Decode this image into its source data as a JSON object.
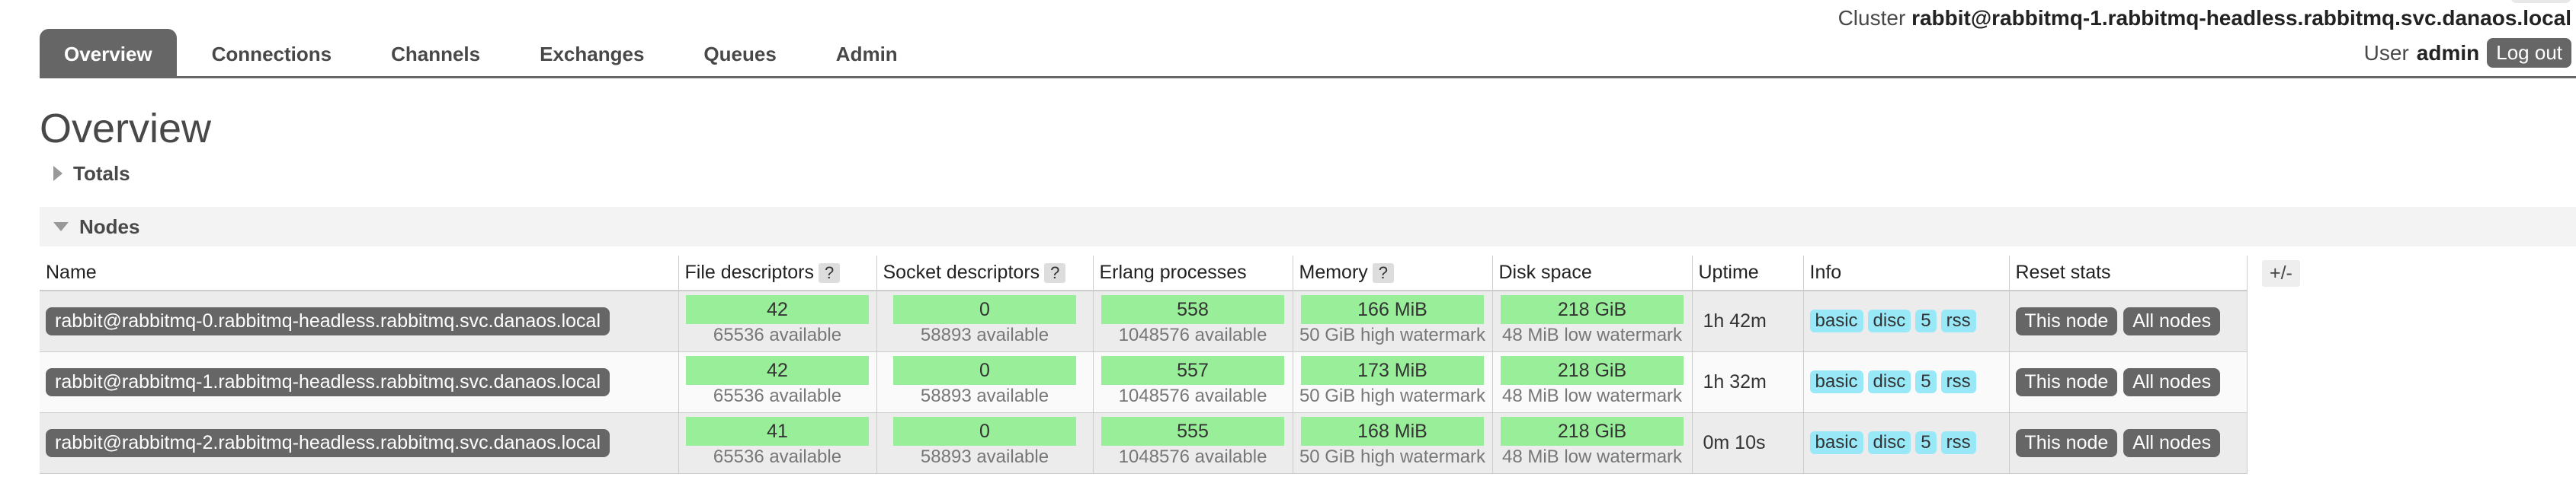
{
  "header": {
    "cluster_label": "Cluster",
    "cluster_name": "rabbit@rabbitmq-1.rabbitmq-headless.rabbitmq.svc.danaos.local",
    "user_label": "User",
    "user_name": "admin",
    "logout_label": "Log out"
  },
  "tabs": [
    {
      "label": "Overview",
      "active": true
    },
    {
      "label": "Connections"
    },
    {
      "label": "Channels"
    },
    {
      "label": "Exchanges"
    },
    {
      "label": "Queues"
    },
    {
      "label": "Admin"
    }
  ],
  "page_title": "Overview",
  "sections": {
    "totals": "Totals",
    "nodes": "Nodes"
  },
  "table": {
    "headers": {
      "name": "Name",
      "file_descriptors": "File descriptors",
      "socket_descriptors": "Socket descriptors",
      "erlang_processes": "Erlang processes",
      "memory": "Memory",
      "disk_space": "Disk space",
      "uptime": "Uptime",
      "info": "Info",
      "reset_stats": "Reset stats"
    },
    "help_glyph": "?",
    "plus_minus": "+/-",
    "rows": [
      {
        "name": "rabbit@rabbitmq-0.rabbitmq-headless.rabbitmq.svc.danaos.local",
        "fd": "42",
        "fd_avail": "65536 available",
        "sock": "0",
        "sock_avail": "58893 available",
        "erl": "558",
        "erl_avail": "1048576 available",
        "mem": "166 MiB",
        "mem_wm": "50 GiB high watermark",
        "disk": "218 GiB",
        "disk_wm": "48 MiB low watermark",
        "uptime": "1h 42m",
        "info": [
          "basic",
          "disc",
          "5",
          "rss"
        ],
        "reset": [
          "This node",
          "All nodes"
        ]
      },
      {
        "name": "rabbit@rabbitmq-1.rabbitmq-headless.rabbitmq.svc.danaos.local",
        "fd": "42",
        "fd_avail": "65536 available",
        "sock": "0",
        "sock_avail": "58893 available",
        "erl": "557",
        "erl_avail": "1048576 available",
        "mem": "173 MiB",
        "mem_wm": "50 GiB high watermark",
        "disk": "218 GiB",
        "disk_wm": "48 MiB low watermark",
        "uptime": "1h 32m",
        "info": [
          "basic",
          "disc",
          "5",
          "rss"
        ],
        "reset": [
          "This node",
          "All nodes"
        ]
      },
      {
        "name": "rabbit@rabbitmq-2.rabbitmq-headless.rabbitmq.svc.danaos.local",
        "fd": "41",
        "fd_avail": "65536 available",
        "sock": "0",
        "sock_avail": "58893 available",
        "erl": "555",
        "erl_avail": "1048576 available",
        "mem": "168 MiB",
        "mem_wm": "50 GiB high watermark",
        "disk": "218 GiB",
        "disk_wm": "48 MiB low watermark",
        "uptime": "0m 10s",
        "info": [
          "basic",
          "disc",
          "5",
          "rss"
        ],
        "reset": [
          "This node",
          "All nodes"
        ]
      }
    ]
  },
  "colors": {
    "tab_active": "#666666",
    "green_bar": "#99ee99",
    "info_badge": "#99e8f8"
  }
}
